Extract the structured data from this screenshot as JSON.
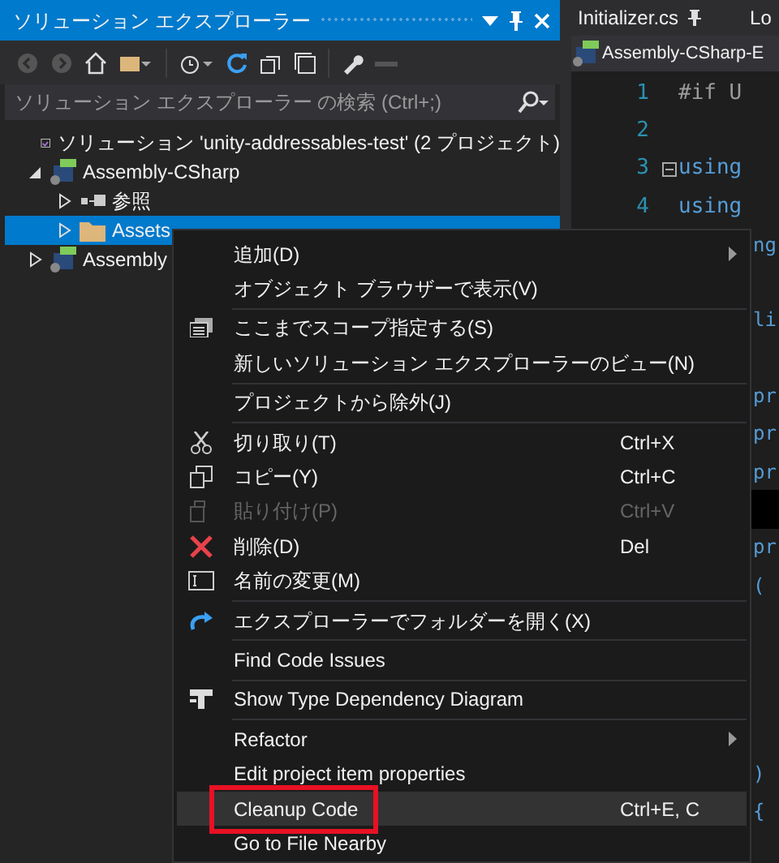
{
  "explorer": {
    "title": "ソリューション エクスプローラー",
    "search": {
      "placeholder": "ソリューション エクスプローラー の検索 (Ctrl+;)"
    },
    "tree": [
      {
        "label": "ソリューション 'unity-addressables-test' (2 プロジェクト)",
        "kind": "solution",
        "selected": false,
        "children": [
          {
            "label": "Assembly-CSharp",
            "kind": "project",
            "expanded": true,
            "selected": false,
            "children": [
              {
                "label": "参照",
                "kind": "references",
                "expanded": false,
                "selected": false
              },
              {
                "label": "Assets",
                "kind": "folder",
                "expanded": false,
                "selected": true
              }
            ]
          },
          {
            "label": "Assembly",
            "kind": "project",
            "expanded": false,
            "selected": false
          }
        ]
      }
    ]
  },
  "editor": {
    "tabs": [
      {
        "label": "Initializer.cs",
        "selected": false,
        "pinned": true
      },
      {
        "label": "Lo",
        "selected": false
      }
    ],
    "navigation": "Assembly-CSharp-E",
    "lines": [
      {
        "kind": "code",
        "number": "1",
        "text": "#if U"
      },
      {
        "kind": "code",
        "number": "2"
      },
      {
        "kind": "code",
        "number": "3",
        "text": "using",
        "collapsible": true
      },
      {
        "kind": "code",
        "number": "4",
        "text": "using"
      },
      {
        "kind": "tail",
        "text": "ng"
      },
      {
        "kind": "blank"
      },
      {
        "kind": "tail",
        "text": "li"
      },
      {
        "kind": "blank"
      },
      {
        "kind": "tail",
        "text": "pr"
      },
      {
        "kind": "tail",
        "text": "pr"
      },
      {
        "kind": "tail",
        "text": "pr"
      },
      {
        "kind": "bar"
      },
      {
        "kind": "tail",
        "text": "pr"
      },
      {
        "kind": "tail",
        "text": "("
      },
      {
        "kind": "blank"
      },
      {
        "kind": "blank"
      },
      {
        "kind": "blank"
      },
      {
        "kind": "blank"
      },
      {
        "kind": "tail",
        "text": ")"
      },
      {
        "kind": "tail",
        "text": "{"
      }
    ]
  },
  "context_menu": [
    {
      "kind": "item",
      "label": "追加(D)",
      "submenu": true,
      "disabled": false,
      "highlighted": false
    },
    {
      "kind": "item",
      "label": "オブジェクト ブラウザーで表示(V)",
      "disabled": false,
      "highlighted": false
    },
    {
      "kind": "separator"
    },
    {
      "kind": "item",
      "label": "ここまでスコープ指定する(S)",
      "disabled": false,
      "highlighted": false
    },
    {
      "kind": "item",
      "label": "新しいソリューション エクスプローラーのビュー(N)",
      "disabled": false,
      "highlighted": false
    },
    {
      "kind": "separator"
    },
    {
      "kind": "item",
      "label": "プロジェクトから除外(J)",
      "disabled": false,
      "highlighted": false
    },
    {
      "kind": "separator"
    },
    {
      "kind": "item",
      "label": "切り取り(T)",
      "shortcut": "Ctrl+X",
      "disabled": false,
      "highlighted": false
    },
    {
      "kind": "item",
      "label": "コピー(Y)",
      "shortcut": "Ctrl+C",
      "disabled": false,
      "highlighted": false
    },
    {
      "kind": "item",
      "label": "貼り付け(P)",
      "shortcut": "Ctrl+V",
      "disabled": true,
      "highlighted": false
    },
    {
      "kind": "item",
      "label": "削除(D)",
      "shortcut": "Del",
      "disabled": false,
      "highlighted": false
    },
    {
      "kind": "item",
      "label": "名前の変更(M)",
      "disabled": false,
      "highlighted": false
    },
    {
      "kind": "separator"
    },
    {
      "kind": "item",
      "label": "エクスプローラーでフォルダーを開く(X)",
      "disabled": false,
      "highlighted": false
    },
    {
      "kind": "separator"
    },
    {
      "kind": "item",
      "label": "Find Code Issues",
      "disabled": false,
      "highlighted": false
    },
    {
      "kind": "separator"
    },
    {
      "kind": "item",
      "label": "Show Type Dependency Diagram",
      "disabled": false,
      "highlighted": false
    },
    {
      "kind": "separator"
    },
    {
      "kind": "item",
      "label": "Refactor",
      "submenu": true,
      "disabled": false,
      "highlighted": false
    },
    {
      "kind": "item",
      "label": "Edit project item properties",
      "disabled": false,
      "highlighted": false
    },
    {
      "kind": "item",
      "label": "Cleanup Code",
      "shortcut": "Ctrl+E, C",
      "disabled": false,
      "highlighted": true,
      "annotated": true
    },
    {
      "kind": "item",
      "label": "Go to File Nearby",
      "disabled": false,
      "highlighted": false
    }
  ]
}
